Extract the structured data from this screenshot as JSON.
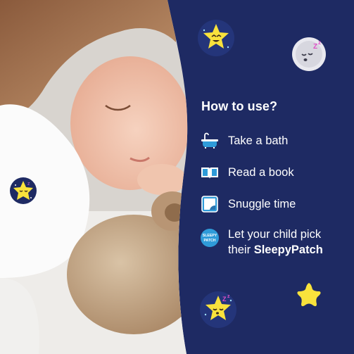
{
  "how_to_use": {
    "title": "How to use?",
    "steps": [
      {
        "label": "Take a bath",
        "icon": "bathtub-icon"
      },
      {
        "label": "Read a book",
        "icon": "open-book-icon"
      },
      {
        "label": "Snuggle time",
        "icon": "blanket-icon"
      },
      {
        "line1": "Let your child pick",
        "line2_prefix": "their ",
        "line2_brand": "SleepyPatch",
        "icon": "sleepypatch-logo-icon"
      }
    ]
  },
  "logo_text": "SLEEPY PATCH",
  "colors": {
    "panel_background": "#1e2a63",
    "accent_blue": "#2f9bd9",
    "star_yellow": "#f9e23c",
    "text": "#ffffff"
  },
  "decorations": [
    "smiling-star-sticker",
    "sleeping-moon-sticker",
    "sleeping-star-sticker",
    "yellow-star",
    "star-patch-on-sleeve"
  ]
}
